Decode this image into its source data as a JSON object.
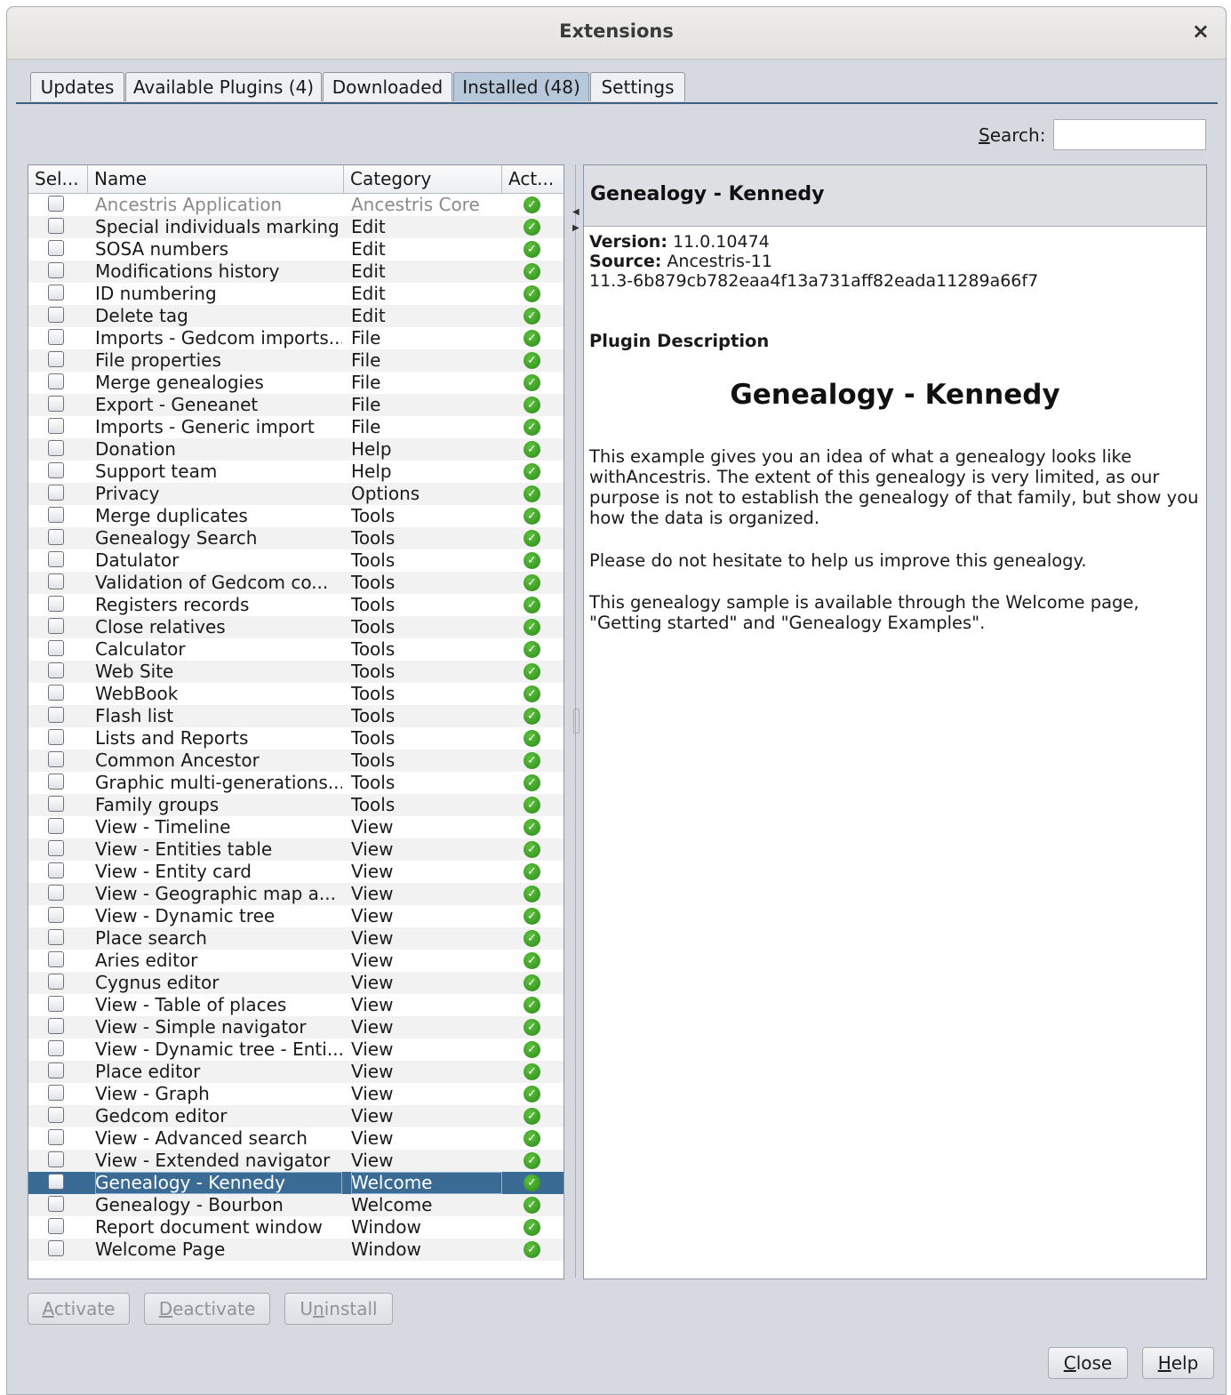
{
  "window": {
    "title": "Extensions",
    "close_glyph": "×"
  },
  "tabs": [
    {
      "label": "Updates"
    },
    {
      "label": "Available Plugins (4)"
    },
    {
      "label": "Downloaded"
    },
    {
      "label": "Installed (48)",
      "active": true
    },
    {
      "label": "Settings"
    }
  ],
  "search": {
    "label_mnemonic": "S",
    "label_rest": "earch:",
    "value": ""
  },
  "table": {
    "columns": [
      "Sel...",
      "Name",
      "Category",
      "Act..."
    ],
    "rows": [
      {
        "name": "Ancestris Application",
        "category": "Ancestris Core",
        "dim": true
      },
      {
        "name": "Special individuals marking",
        "category": "Edit"
      },
      {
        "name": "SOSA numbers",
        "category": "Edit"
      },
      {
        "name": "Modifications history",
        "category": "Edit"
      },
      {
        "name": "ID numbering",
        "category": "Edit"
      },
      {
        "name": "Delete tag",
        "category": "Edit"
      },
      {
        "name": "Imports - Gedcom imports...",
        "category": "File"
      },
      {
        "name": "File properties",
        "category": "File"
      },
      {
        "name": "Merge genealogies",
        "category": "File"
      },
      {
        "name": "Export - Geneanet",
        "category": "File"
      },
      {
        "name": "Imports - Generic import",
        "category": "File"
      },
      {
        "name": "Donation",
        "category": "Help"
      },
      {
        "name": "Support team",
        "category": "Help"
      },
      {
        "name": "Privacy",
        "category": "Options"
      },
      {
        "name": "Merge duplicates",
        "category": "Tools"
      },
      {
        "name": "Genealogy Search",
        "category": "Tools"
      },
      {
        "name": "Datulator",
        "category": "Tools"
      },
      {
        "name": "Validation of Gedcom  co...",
        "category": "Tools"
      },
      {
        "name": "Registers records",
        "category": "Tools"
      },
      {
        "name": "Close relatives",
        "category": "Tools"
      },
      {
        "name": "Calculator",
        "category": "Tools"
      },
      {
        "name": "Web Site",
        "category": "Tools"
      },
      {
        "name": "WebBook",
        "category": "Tools"
      },
      {
        "name": "Flash list",
        "category": "Tools"
      },
      {
        "name": "Lists and Reports",
        "category": "Tools"
      },
      {
        "name": "Common Ancestor",
        "category": "Tools"
      },
      {
        "name": "Graphic multi-generations...",
        "category": "Tools"
      },
      {
        "name": "Family groups",
        "category": "Tools"
      },
      {
        "name": "View - Timeline",
        "category": "View"
      },
      {
        "name": "View - Entities table",
        "category": "View"
      },
      {
        "name": "View - Entity card",
        "category": "View"
      },
      {
        "name": "View - Geographic map a...",
        "category": "View"
      },
      {
        "name": "View - Dynamic tree",
        "category": "View"
      },
      {
        "name": "Place search",
        "category": "View"
      },
      {
        "name": "Aries editor",
        "category": "View"
      },
      {
        "name": "Cygnus editor",
        "category": "View"
      },
      {
        "name": "View - Table of places",
        "category": "View"
      },
      {
        "name": "View - Simple navigator",
        "category": "View"
      },
      {
        "name": "View - Dynamic tree - Enti...",
        "category": "View"
      },
      {
        "name": "Place editor",
        "category": "View"
      },
      {
        "name": "View - Graph",
        "category": "View"
      },
      {
        "name": "Gedcom editor",
        "category": "View"
      },
      {
        "name": "View - Advanced search",
        "category": "View"
      },
      {
        "name": "View - Extended navigator",
        "category": "View"
      },
      {
        "name": "Genealogy - Kennedy",
        "category": "Welcome",
        "selected": true
      },
      {
        "name": "Genealogy - Bourbon",
        "category": "Welcome"
      },
      {
        "name": "Report document window",
        "category": "Window"
      },
      {
        "name": "Welcome Page",
        "category": "Window"
      }
    ]
  },
  "detail": {
    "header": "Genealogy - Kennedy",
    "version_label": "Version:",
    "version_value": " 11.0.10474",
    "source_label": "Source:",
    "source_value": " Ancestris-11",
    "source_hash": "11.3-6b879cb782eaa4f13a731aff82eada11289a66f7",
    "description_heading": "Plugin Description",
    "big_title": "Genealogy - Kennedy",
    "paragraphs": [
      "This example gives you an idea of what a genealogy looks like withAncestris. The extent of this genealogy is very limited, as our purpose is not to establish the genealogy of that family, but show you how the data is organized.",
      "Please do not hesitate to help us improve this genealogy.",
      "This genealogy sample is available through the Welcome page, \"Getting started\" and \"Genealogy Examples\"."
    ]
  },
  "buttons": {
    "activate": {
      "mnemonic": "A",
      "rest": "ctivate"
    },
    "deactivate": {
      "mnemonic": "D",
      "rest": "eactivate"
    },
    "uninstall_pre": "U",
    "uninstall_mnemonic": "n",
    "uninstall_rest": "install",
    "close": {
      "mnemonic": "C",
      "rest": "lose"
    },
    "help": {
      "mnemonic": "H",
      "rest": "elp"
    }
  },
  "icons": {
    "active_status": "check-circle-icon",
    "selection": "checkbox-icon"
  },
  "colors": {
    "selection_row": "#3a6b94",
    "tab_active": "#b6c8da",
    "active_green": "#2b8a1a"
  }
}
